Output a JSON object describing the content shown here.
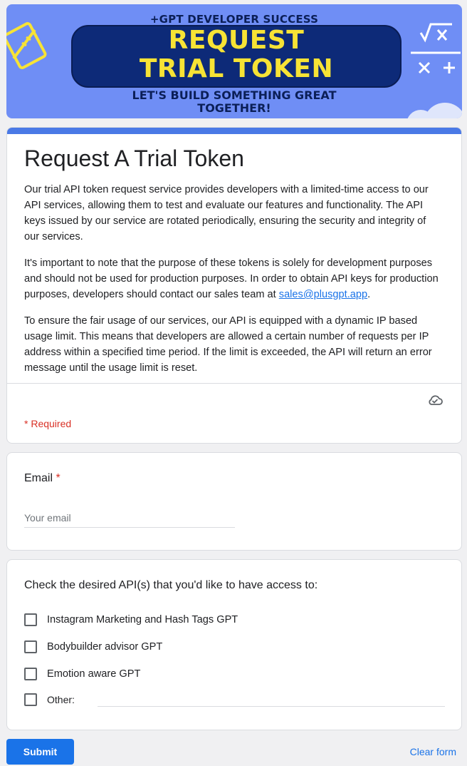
{
  "banner": {
    "top_line": "+GPT DEVELOPER SUCCESS",
    "title_line1": "REQUEST",
    "title_line2": "TRIAL TOKEN",
    "tagline_line1": "LET'S BUILD SOMETHING GREAT",
    "tagline_line2": "TOGETHER!"
  },
  "form": {
    "title": "Request A Trial Token",
    "description": {
      "p1": "Our trial API token request service provides developers with a limited-time access to our API services, allowing them to test and evaluate our features and functionality. The API keys issued by our service are rotated periodically, ensuring the security and integrity of our services.",
      "p2_before": "It's important to note that the purpose of these tokens is solely for development purposes and should not be used for production purposes. In order to obtain API keys for production purposes, developers should contact our sales team at ",
      "p2_link": "sales@plusgpt.app",
      "p2_after": ".",
      "p3": "To ensure the fair usage of our services, our API is equipped with a dynamic IP based usage limit. This means that developers are allowed a certain number of requests per IP address within a specified time period. If the limit is exceeded, the API will return an error message until the usage limit is reset."
    },
    "required_note": "* Required",
    "save_icon": "cloud-check-icon"
  },
  "email_question": {
    "label": "Email",
    "required_marker": "*",
    "placeholder": "Your email"
  },
  "api_question": {
    "label": "Check the desired API(s) that you'd like to have access to:",
    "options": [
      "Instagram Marketing and Hash Tags GPT",
      "Bodybuilder advisor GPT",
      "Emotion aware GPT"
    ],
    "other_label": "Other:"
  },
  "actions": {
    "submit_label": "Submit",
    "clear_label": "Clear form"
  },
  "colors": {
    "accent": "#4a79e6",
    "banner_bg": "#6f8ef5",
    "banner_title": "#f7e335",
    "required": "#d93025",
    "link": "#1a73e8"
  }
}
